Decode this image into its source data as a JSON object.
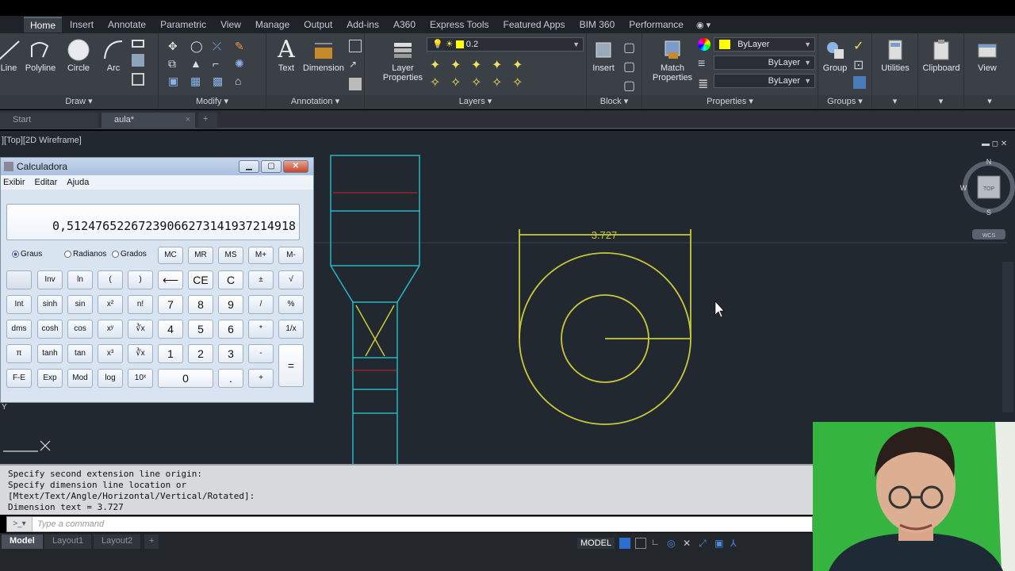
{
  "ribbon": {
    "tabs": [
      "Home",
      "Insert",
      "Annotate",
      "Parametric",
      "View",
      "Manage",
      "Output",
      "Add-ins",
      "A360",
      "Express Tools",
      "Featured Apps",
      "BIM 360",
      "Performance"
    ],
    "active_tab": "Home",
    "draw": {
      "title": "Draw",
      "line": "Line",
      "polyline": "Polyline",
      "circle": "Circle",
      "arc": "Arc"
    },
    "modify": {
      "title": "Modify"
    },
    "annotation": {
      "title": "Annotation",
      "text": "Text",
      "dimension": "Dimension"
    },
    "layers": {
      "title": "Layers",
      "layer_properties_line1": "Layer",
      "layer_properties_line2": "Properties",
      "current_layer": "0.2"
    },
    "block": {
      "title": "Block",
      "insert": "Insert"
    },
    "properties": {
      "title": "Properties",
      "match_line1": "Match",
      "match_line2": "Properties",
      "color": "ByLayer",
      "linetype": "ByLayer",
      "lineweight": "ByLayer"
    },
    "groups": {
      "title": "Groups",
      "group": "Group"
    },
    "utilities": "Utilities",
    "clipboard": "Clipboard",
    "view": "View"
  },
  "doc_tabs": {
    "start": "Start",
    "active": "aula*"
  },
  "viewport": {
    "label": "][Top][2D Wireframe]"
  },
  "viewcube": {
    "n": "N",
    "s": "S",
    "w": "W",
    "top": "TOP",
    "wcs": "WCS"
  },
  "drawing": {
    "dimension_text": "3.727",
    "ucs_y": "Y"
  },
  "calculator": {
    "title": "Calculadora",
    "menu": [
      "Exibir",
      "Editar",
      "Ajuda"
    ],
    "display": "0,5124765226723906627314193721491​8",
    "modes": [
      "Graus",
      "Radianos",
      "Grados"
    ],
    "mem": [
      "MC",
      "MR",
      "MS",
      "M+",
      "M-"
    ],
    "row1": [
      "",
      "Inv",
      "ln",
      "(",
      ")",
      "⟵",
      "CE",
      "C",
      "±",
      "√"
    ],
    "row2": [
      "Int",
      "sinh",
      "sin",
      "x²",
      "n!",
      "7",
      "8",
      "9",
      "/",
      "%"
    ],
    "row3": [
      "dms",
      "cosh",
      "cos",
      "xʸ",
      "∛x",
      "4",
      "5",
      "6",
      "*",
      "1/x"
    ],
    "row4": [
      "π",
      "tanh",
      "tan",
      "x³",
      "∛x",
      "1",
      "2",
      "3",
      "-",
      "="
    ],
    "row5": [
      "F-E",
      "Exp",
      "Mod",
      "log",
      "10ˣ",
      "0",
      ".",
      "+"
    ]
  },
  "command": {
    "history": [
      "Specify second extension line origin:",
      "Specify dimension line location or",
      "[Mtext/Text/Angle/Horizontal/Vertical/Rotated]:",
      "Dimension text = 3.727"
    ],
    "placeholder": "Type a command"
  },
  "layout_tabs": [
    "Model",
    "Layout1",
    "Layout2"
  ],
  "status": {
    "model": "MODEL"
  },
  "colors": {
    "cyan": "#29b6c6",
    "yellow": "#c8c83a",
    "red": "#c62828",
    "canvas": "#212830"
  }
}
